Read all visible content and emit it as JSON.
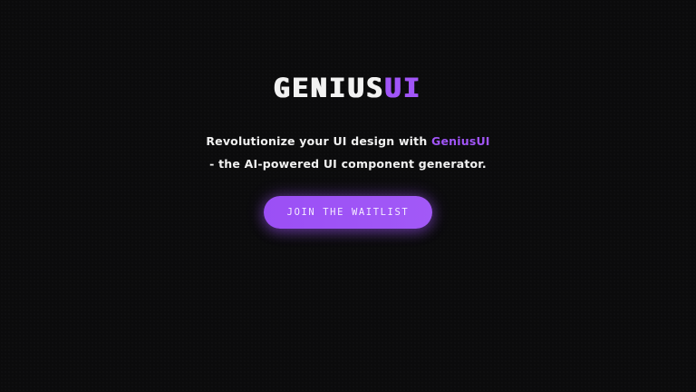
{
  "logo": {
    "part1": "GENIUS",
    "part2": "UI"
  },
  "tagline": {
    "line1_prefix": "Revolutionize your UI design with ",
    "brand": "GeniusUI",
    "line2": "- the AI-powered UI component generator."
  },
  "cta": {
    "label": "JOIN THE WAITLIST"
  },
  "colors": {
    "accent": "#a155f7",
    "background": "#0b0b0c",
    "text": "#f1f1f1"
  }
}
